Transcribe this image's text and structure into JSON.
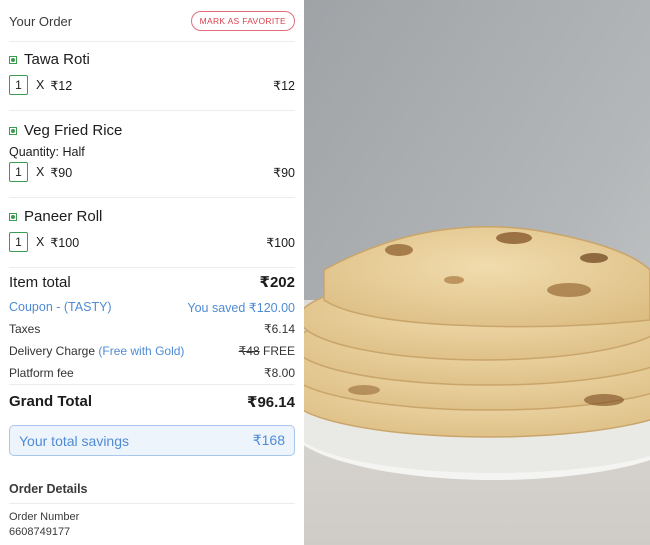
{
  "order": {
    "title": "Your Order",
    "favorite_label": "MARK AS FAVORITE"
  },
  "items": [
    {
      "name": "Tawa Roti",
      "qty": "1",
      "x": "X",
      "unit_price": "₹12",
      "total": "₹12"
    },
    {
      "name": "Veg Fried Rice",
      "quantity_text": "Quantity: Half",
      "qty": "1",
      "x": "X",
      "unit_price": "₹90",
      "total": "₹90"
    },
    {
      "name": "Paneer Roll",
      "qty": "1",
      "x": "X",
      "unit_price": "₹100",
      "total": "₹100"
    }
  ],
  "bill": {
    "item_total_label": "Item total",
    "item_total_value": "₹202",
    "coupon_label": "Coupon - (TASTY)",
    "coupon_saved": "You saved ₹120.00",
    "taxes_label": "Taxes",
    "taxes_value": "₹6.14",
    "delivery_label": "Delivery Charge",
    "delivery_note": "(Free with Gold)",
    "delivery_old": "₹48",
    "delivery_value": "FREE",
    "platform_label": "Platform fee",
    "platform_value": "₹8.00",
    "grand_total_label": "Grand Total",
    "grand_total_value": "₹96.14",
    "savings_label": "Your total savings",
    "savings_value": "₹168"
  },
  "details": {
    "title": "Order Details",
    "order_number_label": "Order Number",
    "order_number_value": "6608749177"
  },
  "image": {
    "subject": "stack of tawa roti flatbreads on a white plate",
    "colors": {
      "wall": "#a9acae",
      "roti": "#e9cf9a",
      "plate": "#f2f2f0",
      "cloth": "#d8d6d2"
    }
  }
}
